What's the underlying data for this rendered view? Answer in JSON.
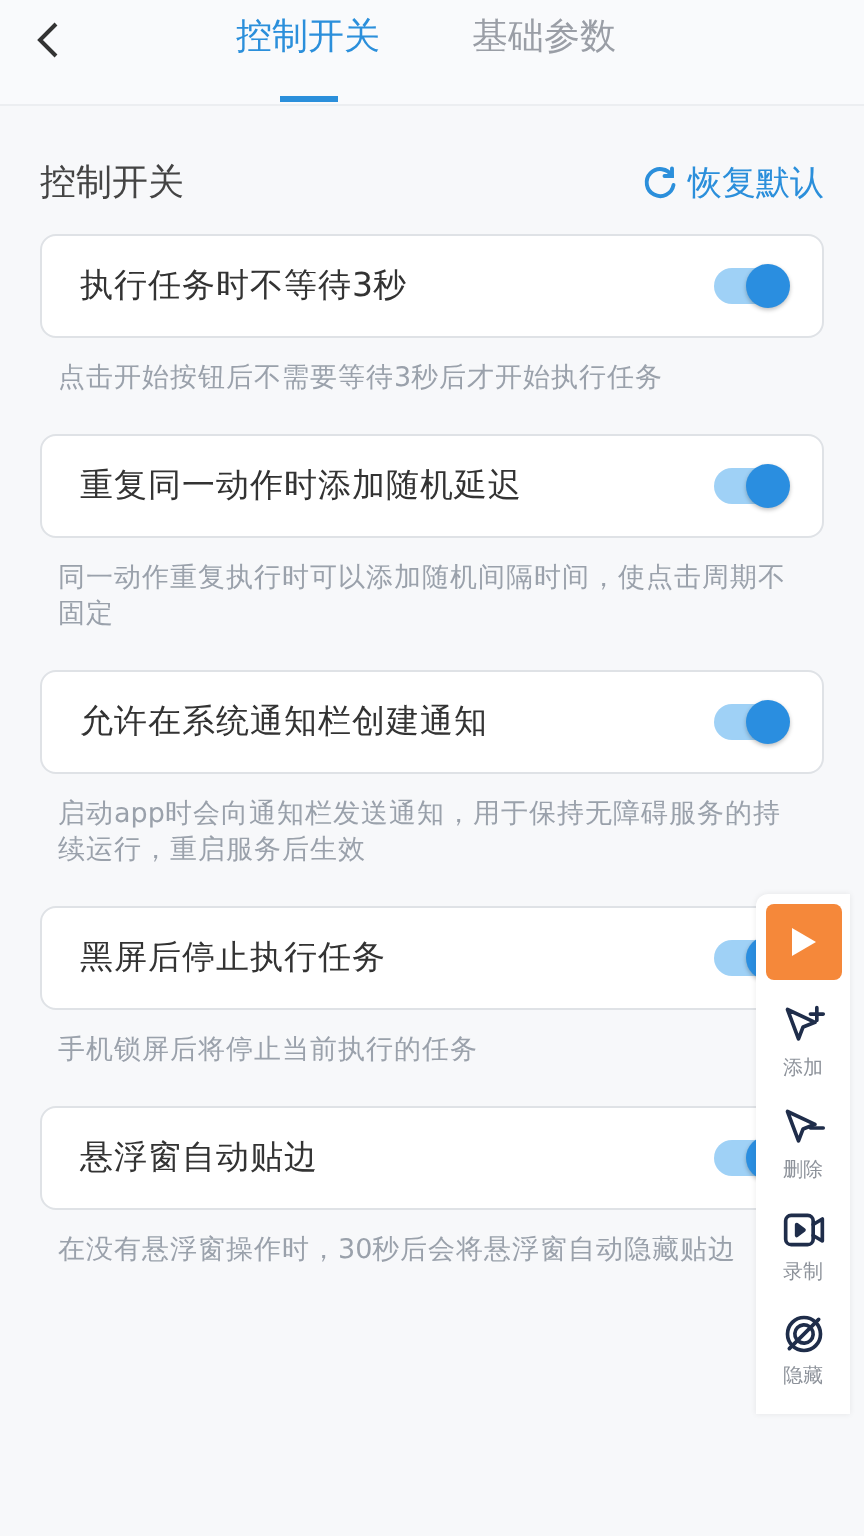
{
  "tabs": [
    {
      "label": "控制开关",
      "selected": true
    },
    {
      "label": "基础参数",
      "selected": false
    }
  ],
  "section": {
    "title": "控制开关",
    "reset_label": "恢复默认"
  },
  "settings": [
    {
      "label": "执行任务时不等待3秒",
      "description": "点击开始按钮后不需要等待3秒后才开始执行任务",
      "on": true
    },
    {
      "label": "重复同一动作时添加随机延迟",
      "description": "同一动作重复执行时可以添加随机间隔时间，使点击周期不固定",
      "on": true
    },
    {
      "label": "允许在系统通知栏创建通知",
      "description": "启动app时会向通知栏发送通知，用于保持无障碍服务的持续运行，重启服务后生效",
      "on": true
    },
    {
      "label": "黑屏后停止执行任务",
      "description": "手机锁屏后将停止当前执行的任务",
      "on": true
    },
    {
      "label": "悬浮窗自动贴边",
      "description": "在没有悬浮窗操作时，30秒后会将悬浮窗自动隐藏贴边",
      "on": true
    }
  ],
  "floating_toolbar": {
    "items": [
      {
        "kind": "add",
        "label": "添加"
      },
      {
        "kind": "remove",
        "label": "删除"
      },
      {
        "kind": "record",
        "label": "录制"
      },
      {
        "kind": "hide",
        "label": "隐藏"
      }
    ]
  }
}
